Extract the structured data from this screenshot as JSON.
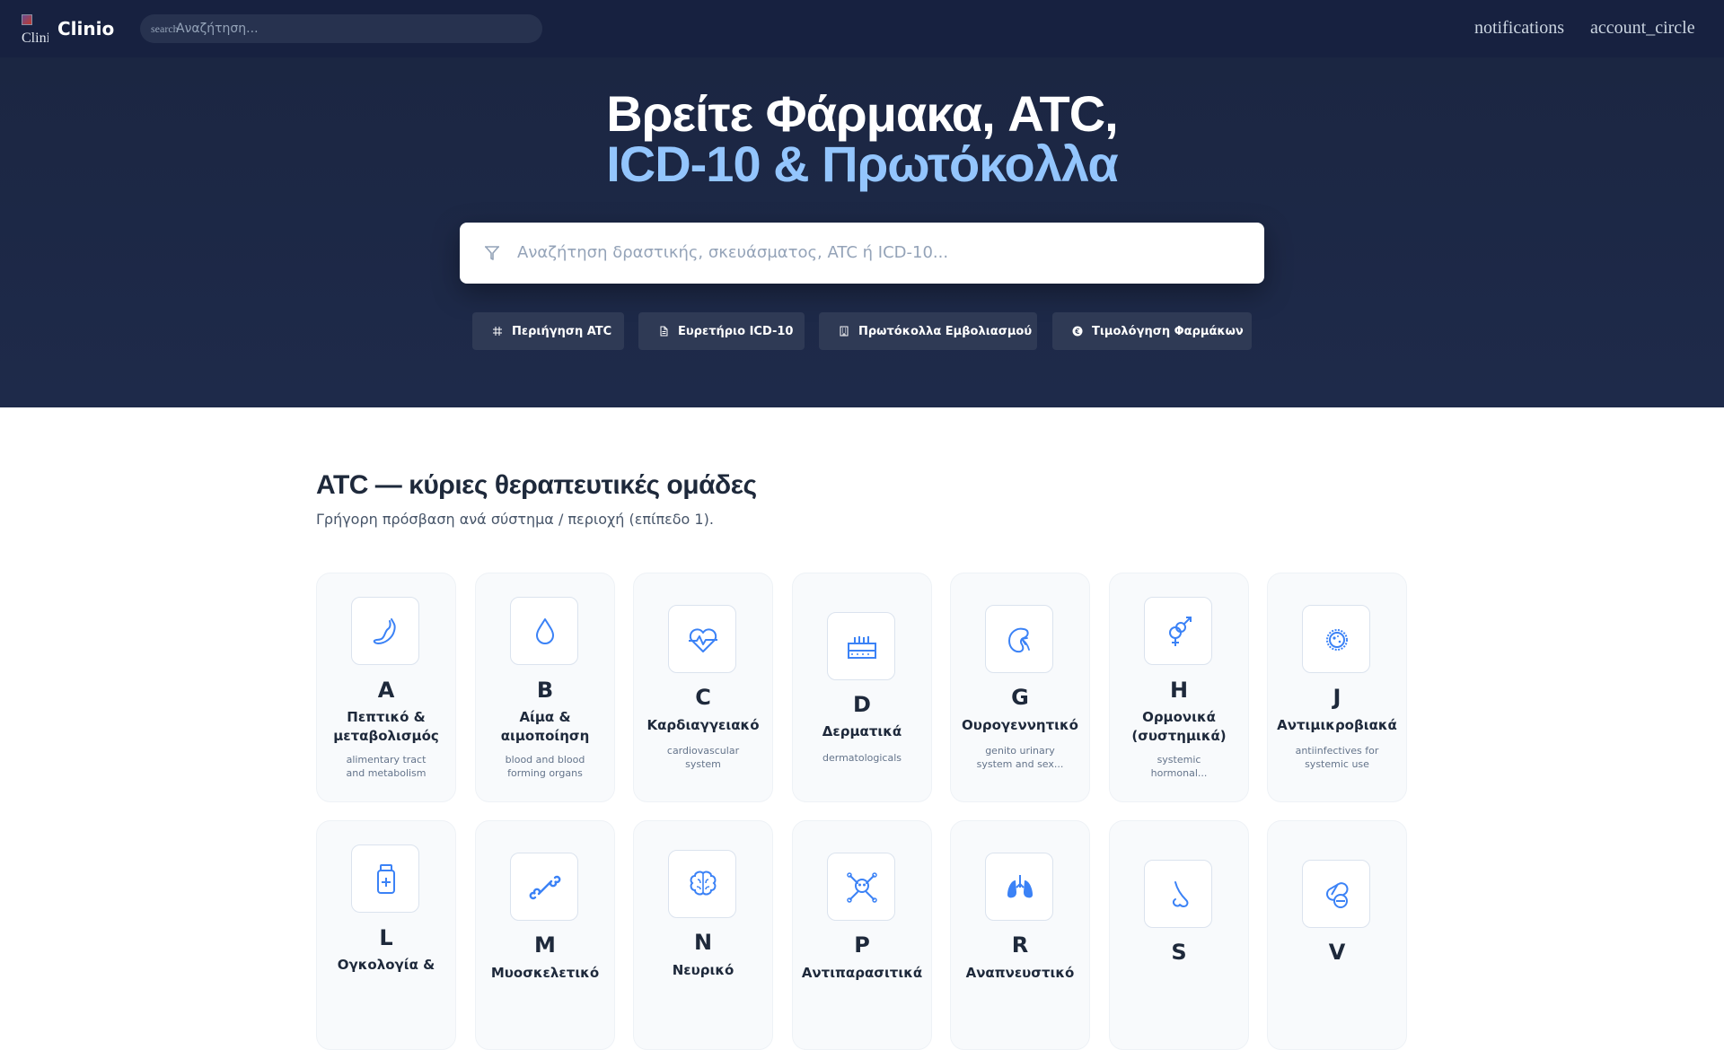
{
  "nav": {
    "logo_alt": "Clinio",
    "brand": "Clinio",
    "search_icon_text": "search",
    "search_placeholder": "Αναζήτηση...",
    "notifications_text": "notifications",
    "account_text": "account_circle"
  },
  "hero": {
    "title_line1": "Βρείτε Φάρμακα, ATC,",
    "title_line2": "ICD-10 & Πρωτόκολλα",
    "search_placeholder": "Αναζήτηση δραστικής, σκευάσματος, ATC ή ICD-10...",
    "chips": [
      {
        "label": "Περιήγηση ATC",
        "icon": "hierarchy-icon"
      },
      {
        "label": "Ευρετήριο ICD-10",
        "icon": "document-icon"
      },
      {
        "label": "Πρωτόκολλα Εμβολιασμού",
        "icon": "building-icon"
      },
      {
        "label": "Τιμολόγηση Φαρμάκων",
        "icon": "euro-icon"
      }
    ]
  },
  "atc": {
    "title": "ATC — κύριες θεραπευτικές ομάδες",
    "subtitle": "Γρήγορη πρόσβαση ανά σύστημα / περιοχή (επίπεδο 1).",
    "groups": [
      {
        "letter": "A",
        "name_lines": [
          "Πεπτικό &",
          "μεταβολισμός"
        ],
        "desc_lines": [
          "alimentary tract",
          "and metabolism"
        ],
        "icon": "stomach-icon"
      },
      {
        "letter": "B",
        "name_lines": [
          "Αίμα &",
          "αιμοποίηση"
        ],
        "desc_lines": [
          "blood and blood",
          "forming organs"
        ],
        "icon": "blood-drop-icon"
      },
      {
        "letter": "C",
        "name_lines": [
          "Καρδιαγγειακό"
        ],
        "desc_lines": [
          "cardiovascular",
          "system"
        ],
        "icon": "heart-pulse-icon"
      },
      {
        "letter": "D",
        "name_lines": [
          "Δερματικά"
        ],
        "desc_lines": [
          "dermatologicals"
        ],
        "icon": "skin-icon"
      },
      {
        "letter": "G",
        "name_lines": [
          "Ουρογεννητικό"
        ],
        "desc_lines": [
          "genito urinary",
          "system and sex..."
        ],
        "icon": "kidney-icon"
      },
      {
        "letter": "H",
        "name_lines": [
          "Ορμονικά",
          "(συστημικά)"
        ],
        "desc_lines": [
          "systemic",
          "hormonal..."
        ],
        "icon": "gender-icon"
      },
      {
        "letter": "J",
        "name_lines": [
          "Αντιμικροβιακά"
        ],
        "desc_lines": [
          "antiinfectives for",
          "systemic use"
        ],
        "icon": "microbe-icon"
      },
      {
        "letter": "L",
        "name_lines": [
          "Ογκολογία &"
        ],
        "desc_lines": [],
        "icon": "medicine-bottle-icon"
      },
      {
        "letter": "M",
        "name_lines": [
          "Μυοσκελετικό"
        ],
        "desc_lines": [],
        "icon": "bone-icon"
      },
      {
        "letter": "N",
        "name_lines": [
          "Νευρικό"
        ],
        "desc_lines": [],
        "icon": "brain-icon"
      },
      {
        "letter": "P",
        "name_lines": [
          "Αντιπαρασιτικά"
        ],
        "desc_lines": [],
        "icon": "skull-crossbones-icon"
      },
      {
        "letter": "R",
        "name_lines": [
          "Αναπνευστικό"
        ],
        "desc_lines": [],
        "icon": "lungs-icon"
      },
      {
        "letter": "S",
        "name_lines": [],
        "desc_lines": [],
        "icon": "nose-icon"
      },
      {
        "letter": "V",
        "name_lines": [],
        "desc_lines": [],
        "icon": "pill-icon"
      }
    ]
  },
  "colors": {
    "nav_bg": "#172140",
    "hero_bg": "#1e2a4a",
    "accent": "#93c5fd",
    "icon_blue": "#3b82f6"
  }
}
